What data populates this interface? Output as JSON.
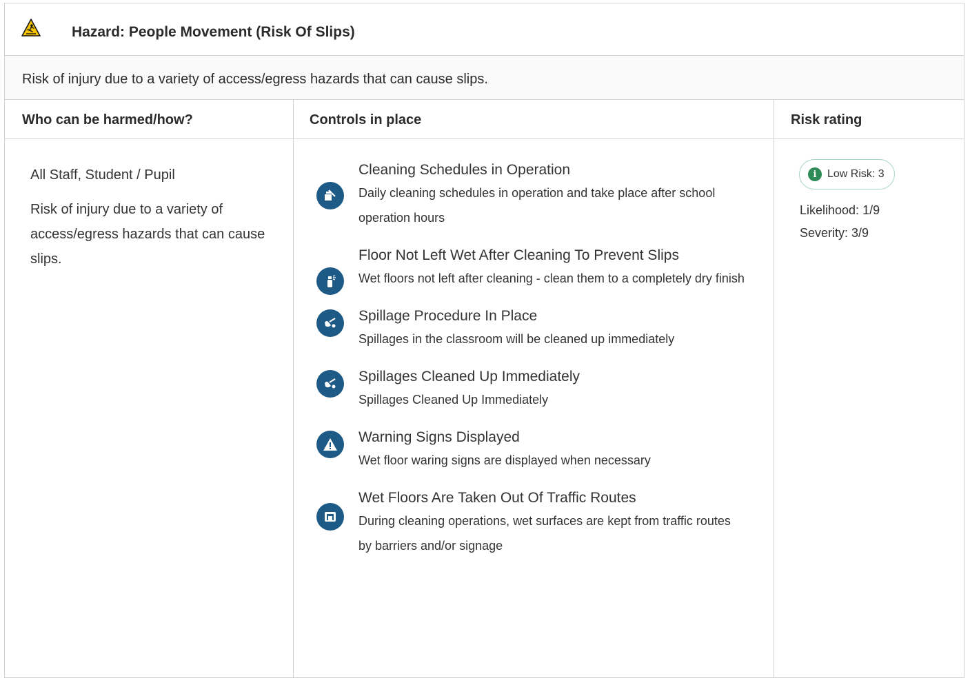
{
  "hazard": {
    "title": "Hazard:  People Movement (Risk Of Slips)",
    "icon": "slip-hazard-warning-icon",
    "description": "Risk of injury due to a variety of access/egress hazards that can cause slips."
  },
  "columns": {
    "who": "Who can be harmed/how?",
    "controls": "Controls in place",
    "risk": "Risk rating"
  },
  "who": {
    "groups": "All Staff, Student / Pupil",
    "harm": "Risk of injury due to a variety of access/egress hazards that can cause slips."
  },
  "controls": [
    {
      "icon": "cleaning-schedule-icon",
      "title": "Cleaning Schedules in Operation",
      "desc": "Daily cleaning schedules in operation and take place after school operation hours"
    },
    {
      "icon": "spray-bottle-icon",
      "title": "Floor Not Left Wet After Cleaning To Prevent Slips",
      "desc": "Wet floors not left after cleaning - clean them to a completely dry finish"
    },
    {
      "icon": "spillage-wipe-icon",
      "title": "Spillage Procedure In Place",
      "desc": "Spillages in the classroom will be cleaned up immediately"
    },
    {
      "icon": "spillage-wipe-icon",
      "title": "Spillages Cleaned Up Immediately",
      "desc": "Spillages Cleaned Up Immediately"
    },
    {
      "icon": "warning-triangle-icon",
      "title": "Warning Signs Displayed",
      "desc": "Wet floor waring signs are displayed when necessary"
    },
    {
      "icon": "barrier-icon",
      "title": "Wet Floors Are Taken Out Of Traffic Routes",
      "desc": "During cleaning operations, wet surfaces are kept from traffic routes by barriers and/or signage"
    }
  ],
  "risk": {
    "badge": "Low Risk: 3",
    "badge_color": "#2e8b57",
    "likelihood": "Likelihood: 1/9",
    "severity": "Severity: 3/9"
  },
  "colors": {
    "control_icon_bg": "#1d5a86",
    "border": "#cfd3d6"
  }
}
